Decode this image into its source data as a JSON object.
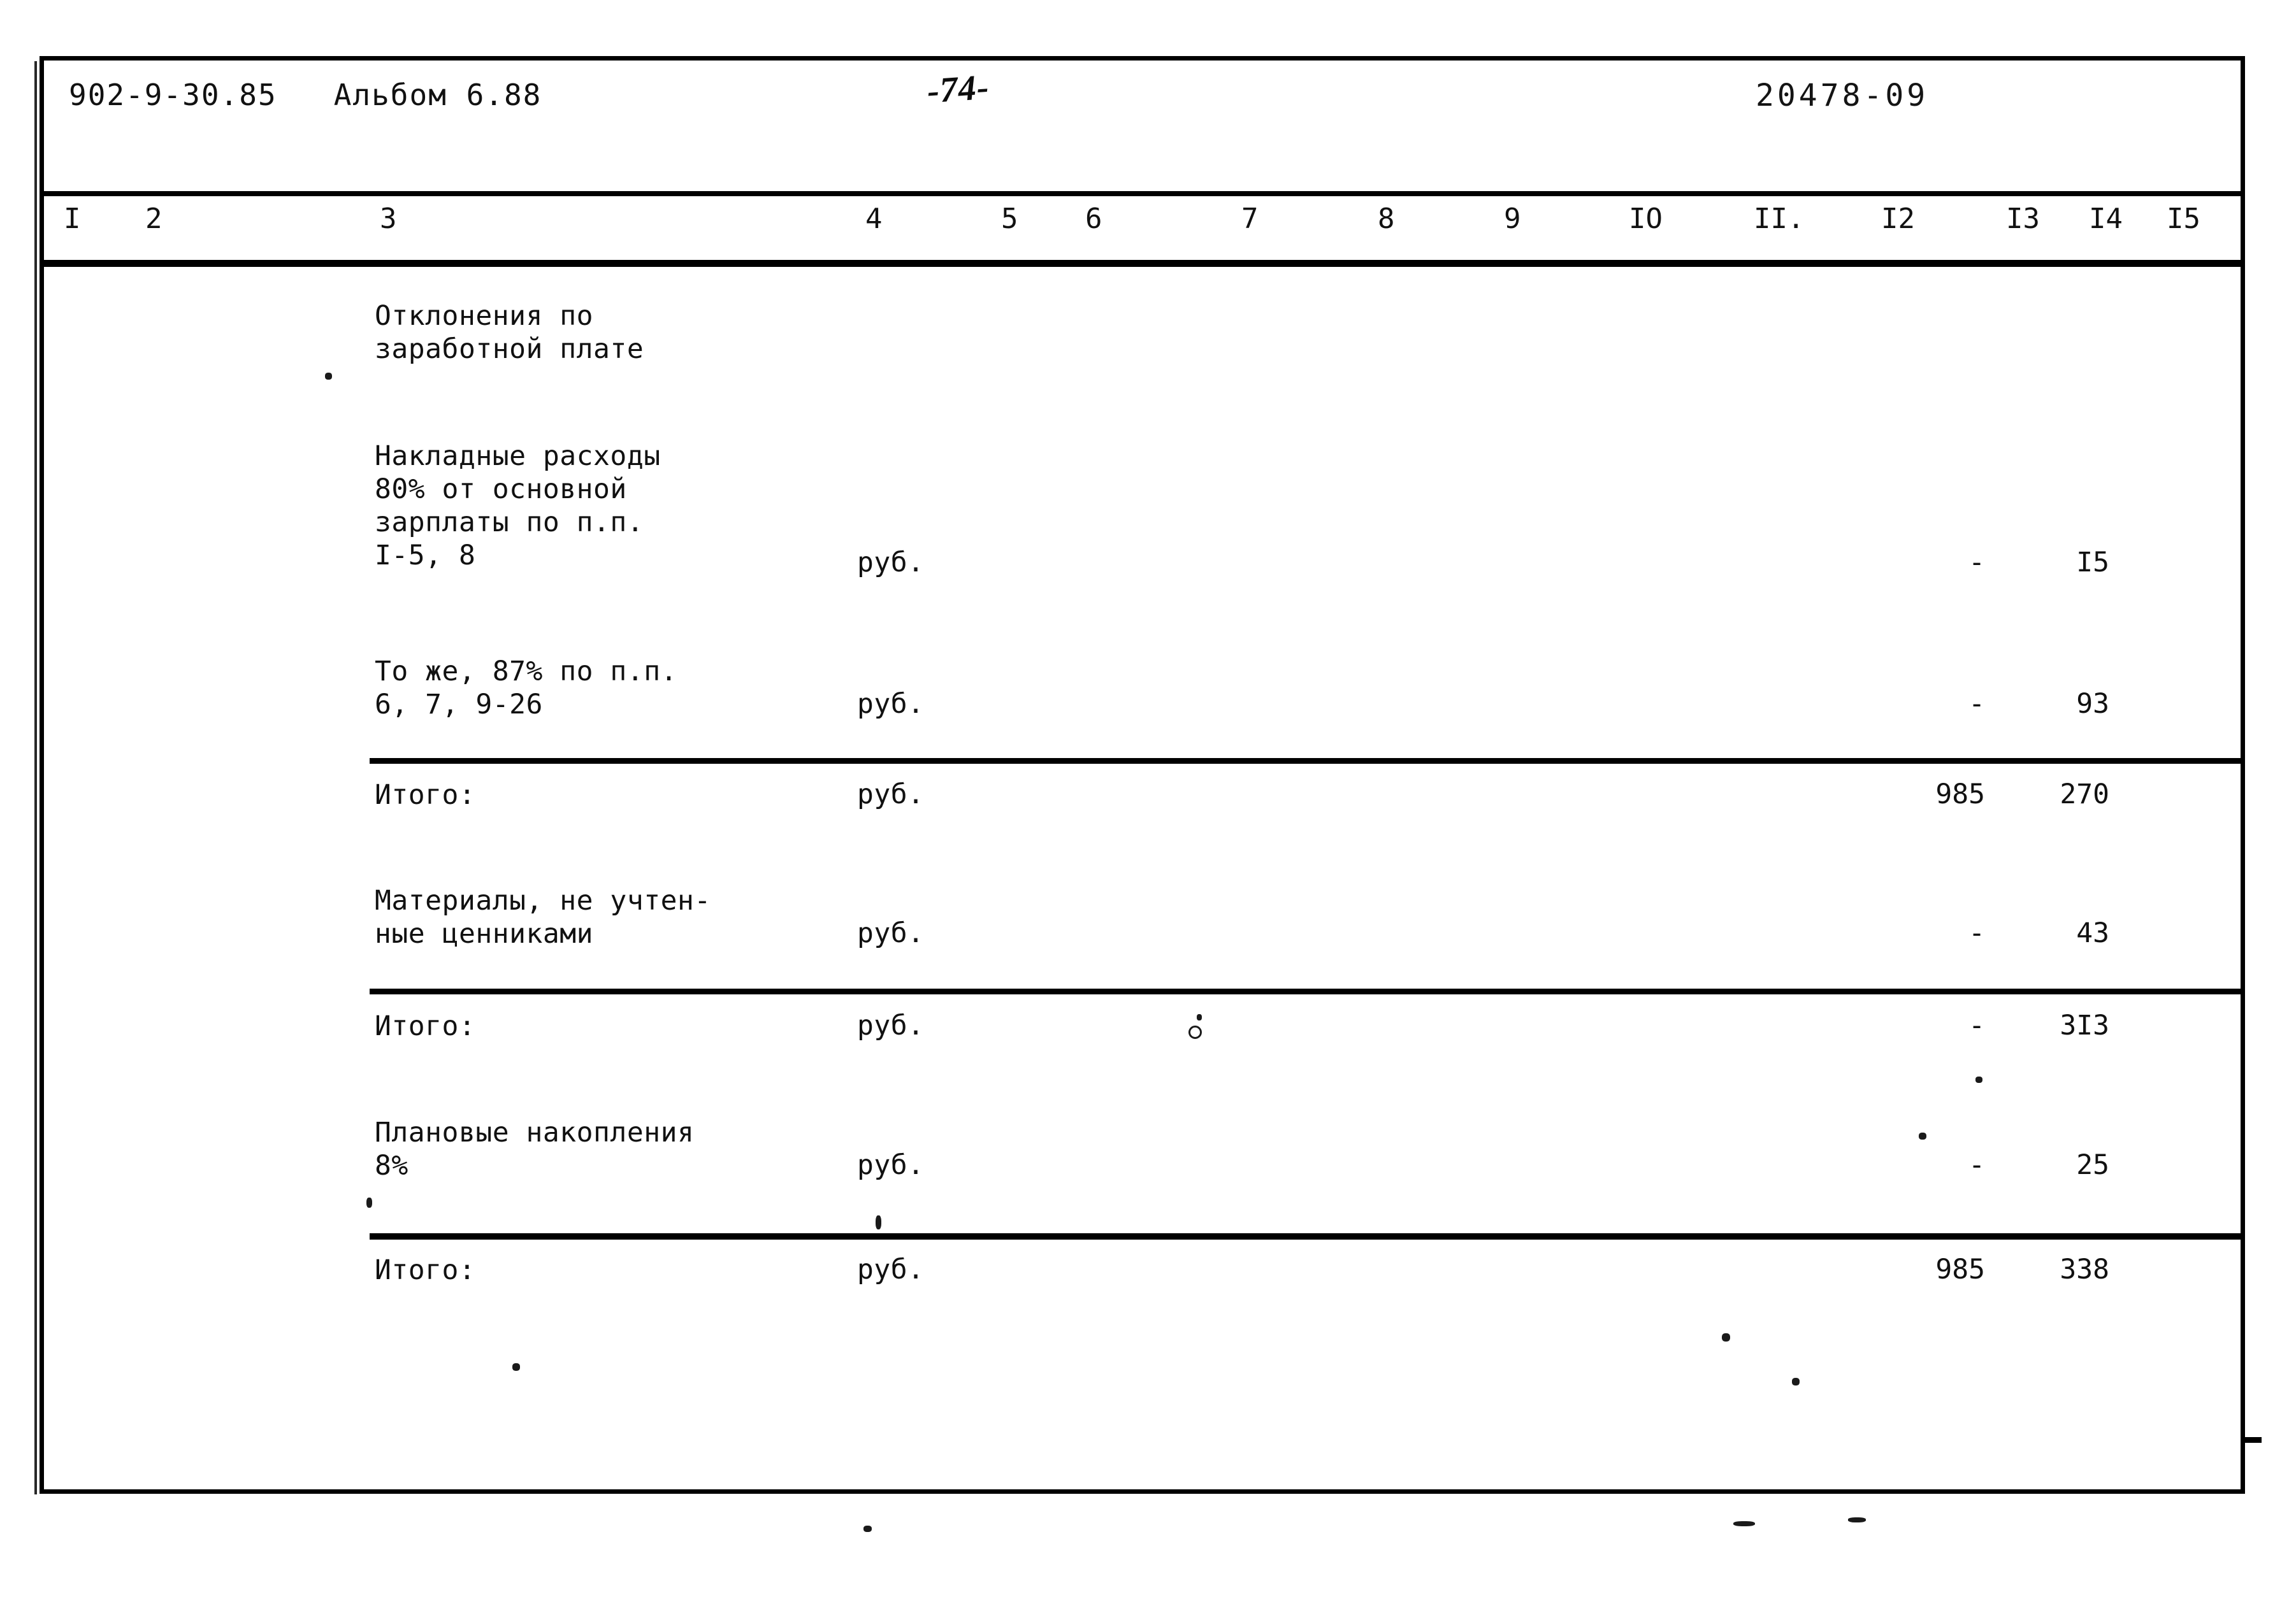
{
  "document": {
    "header_code": "902-9-30.85   Альбом 6.88",
    "page_number": "-74-",
    "stamp_code": "20478-09"
  },
  "table": {
    "column_numbers": [
      "I",
      "2",
      "3",
      "4",
      "5",
      "6",
      "7",
      "8",
      "9",
      "IO",
      "II.",
      "I2",
      "I3",
      "I4",
      "I5"
    ],
    "rows": [
      {
        "description": "Отклонения по\nзаработной плате",
        "unit": "",
        "col12": "",
        "col13": ""
      },
      {
        "description": "Накладные расходы\n80% от основной\nзарплаты по п.п.\nI-5, 8",
        "unit": "руб.",
        "col12": "-",
        "col13": "I5"
      },
      {
        "description": "То же, 87% по п.п.\n6, 7, 9-26",
        "unit": "руб.",
        "col12": "-",
        "col13": "93"
      },
      {
        "description": "Итого:",
        "unit": "руб.",
        "col12": "985",
        "col13": "270"
      },
      {
        "description": "Материалы, не учтен-\nные ценниками",
        "unit": "руб.",
        "col12": "-",
        "col13": "43"
      },
      {
        "description": "Итого:",
        "unit": "руб.",
        "col12": "-",
        "col13": "3I3"
      },
      {
        "description": "Плановые накопления\n8%",
        "unit": "руб.",
        "col12": "-",
        "col13": "25"
      },
      {
        "description": "Итого:",
        "unit": "руб.",
        "col12": "985",
        "col13": "338"
      }
    ]
  }
}
